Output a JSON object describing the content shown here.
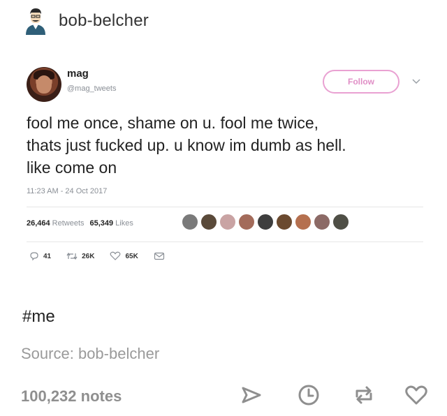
{
  "post": {
    "blog_name": "bob-belcher",
    "tag": "#me",
    "source_label": "Source:",
    "source_value": "bob-belcher",
    "notes": "100,232 notes"
  },
  "tweet": {
    "name": "mag",
    "handle": "@mag_tweets",
    "follow_label": "Follow",
    "text_line1": "fool me once, shame on u. fool me twice,",
    "text_line2": "thats just fucked up. u know im dumb as hell.",
    "text_line3": "like come on",
    "timestamp": "11:23 AM - 24 Oct 2017",
    "retweets_count": "26,464",
    "retweets_label": "Retweets",
    "likes_count": "65,349",
    "likes_label": "Likes",
    "reply_count": "41",
    "retweet_action_count": "26K",
    "like_action_count": "65K"
  },
  "colors": {
    "follow_accent": "#e08ec6",
    "follow_border": "#e9a1d2",
    "muted_text": "#8a8f96",
    "footer_icons": "#8f8f8f"
  },
  "icons": {
    "footer": [
      "share-icon",
      "clock-icon",
      "reblog-icon",
      "heart-icon"
    ],
    "tweet_actions": [
      "reply-icon",
      "retweet-icon",
      "like-icon",
      "dm-icon"
    ]
  }
}
